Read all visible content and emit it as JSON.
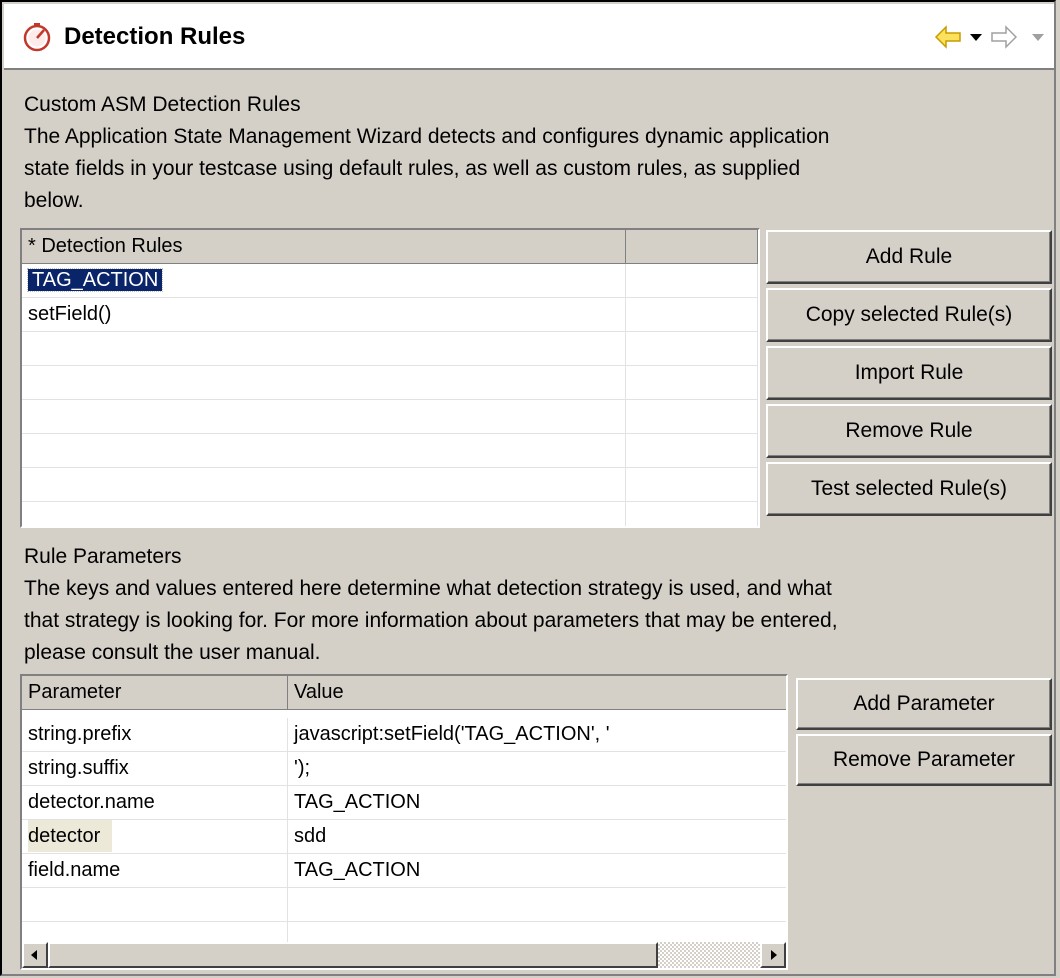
{
  "title": {
    "text": "Detection Rules",
    "icon": "stopwatch-icon"
  },
  "nav": {
    "back_icon": "back-arrow-icon",
    "menu_icon": "chevron-down-icon",
    "forward_icon": "forward-arrow-icon"
  },
  "intro": {
    "heading": "Custom ASM Detection Rules",
    "lines": [
      "The Application State Management Wizard detects and configures dynamic application",
      "state fields in your testcase using default rules, as well as custom rules, as supplied",
      "below."
    ]
  },
  "rules_table": {
    "columns": [
      "* Detection Rules",
      ""
    ],
    "rows": [
      {
        "name": "TAG_ACTION",
        "selected": true
      },
      {
        "name": "setField()",
        "selected": false
      }
    ]
  },
  "rule_buttons": {
    "add": "Add Rule",
    "copy": "Copy selected Rule(s)",
    "import": "Import Rule",
    "remove": "Remove Rule",
    "test": "Test selected Rule(s)"
  },
  "params_intro": {
    "heading": "Rule Parameters",
    "lines": [
      "The keys and values entered here determine what detection strategy is used, and what",
      "that strategy is looking for. For more information about parameters that may be entered,",
      "please consult the user manual."
    ]
  },
  "params_table": {
    "columns": [
      "Parameter",
      "Value"
    ],
    "rows": [
      {
        "param": "string.prefix",
        "value": "javascript:setField('TAG_ACTION', '"
      },
      {
        "param": "string.suffix",
        "value": "');"
      },
      {
        "param": "detector.name",
        "value": "TAG_ACTION"
      },
      {
        "param": "detector",
        "value": "sdd"
      },
      {
        "param": "field.name",
        "value": "TAG_ACTION"
      }
    ]
  },
  "param_buttons": {
    "add": "Add Parameter",
    "remove": "Remove Parameter"
  }
}
